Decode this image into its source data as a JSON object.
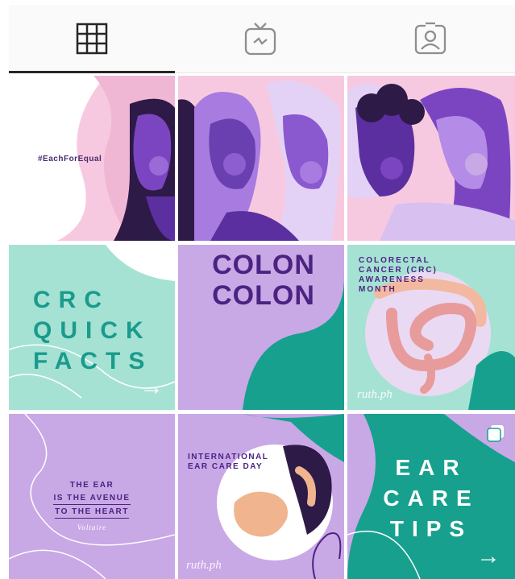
{
  "tabs": [
    {
      "name": "grid-icon",
      "active": true
    },
    {
      "name": "igtv-icon",
      "active": false
    },
    {
      "name": "tagged-icon",
      "active": false
    }
  ],
  "colors": {
    "purple": "#6a3fb0",
    "dark_purple": "#4b2382",
    "lilac": "#c9a8e6",
    "pink": "#f7c9e0",
    "mint": "#a5e2d4",
    "teal": "#17a08e"
  },
  "posts": {
    "each_for_equal": {
      "hashtag": "#EachForEqual"
    },
    "crc_quick_facts": {
      "title": "CRC\nQUICK\nFACTS",
      "arrow": "→"
    },
    "colon": {
      "text": "COLON\nCOLON"
    },
    "crc_awareness": {
      "title": "COLORECTAL\nCANCER (CRC)\nAWARENESS\nMONTH",
      "watermark": "ruth.ph"
    },
    "ear_quote": {
      "line1": "THE EAR",
      "line2": "IS THE AVENUE",
      "line3": "TO THE HEART",
      "author": "Voltaire"
    },
    "ear_care_day": {
      "title": "INTERNATIONAL\nEAR CARE DAY",
      "watermark": "ruth.ph"
    },
    "ear_care_tips": {
      "title": "EAR\nCARE\nTIPS",
      "arrow": "→"
    }
  }
}
